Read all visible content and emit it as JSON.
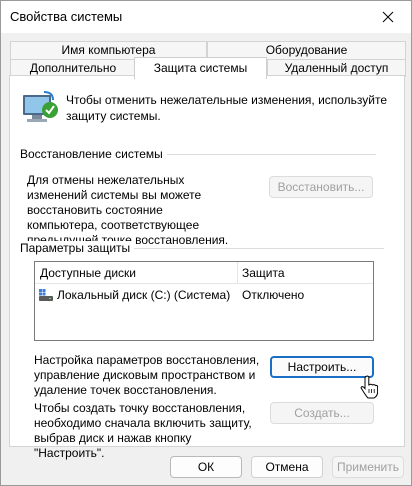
{
  "window": {
    "title": "Свойства системы"
  },
  "tabs": {
    "row1": [
      "Имя компьютера",
      "Оборудование"
    ],
    "row2": [
      "Дополнительно",
      "Защита системы",
      "Удаленный доступ"
    ],
    "active": "Защита системы"
  },
  "intro": "Чтобы отменить нежелательные изменения, используйте защиту системы.",
  "restore": {
    "group_label": "Восстановление системы",
    "description": "Для отмены нежелательных изменений системы вы можете восстановить состояние компьютера, соответствующее предыдущей точке восстановления.",
    "button": "Восстановить..."
  },
  "protection": {
    "group_label": "Параметры защиты",
    "columns": [
      "Доступные диски",
      "Защита"
    ],
    "rows": [
      {
        "disk": "Локальный диск (C:) (Система)",
        "status": "Отключено"
      }
    ],
    "configure_text": "Настройка параметров восстановления, управление дисковым пространством и удаление точек восстановления.",
    "configure_button": "Настроить...",
    "create_text": "Чтобы создать точку восстановления, необходимо сначала включить защиту, выбрав диск и нажав кнопку \"Настроить\".",
    "create_button": "Создать..."
  },
  "footer": {
    "ok": "ОК",
    "cancel": "Отмена",
    "apply": "Применить"
  },
  "colors": {
    "accent": "#1a6fc5",
    "disabled_text": "#a0a0a0"
  }
}
